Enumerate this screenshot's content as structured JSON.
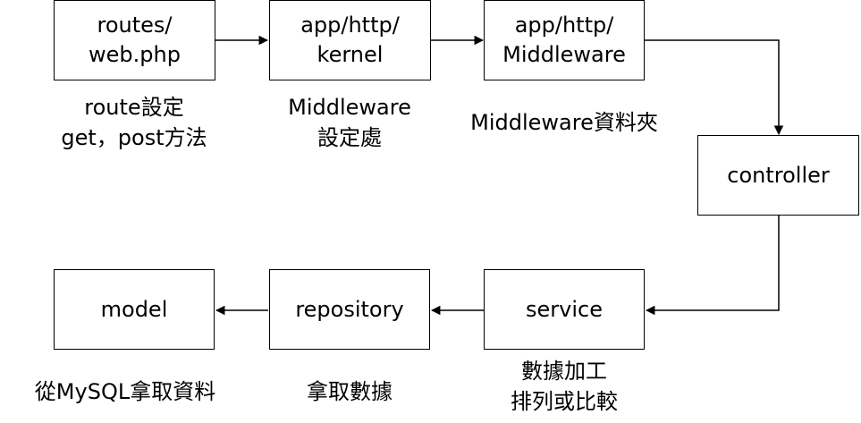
{
  "nodes": {
    "routes": "routes/\nweb.php",
    "kernel": "app/http/\nkernel",
    "middleware": "app/http/\nMiddleware",
    "controller": "controller",
    "service": "service",
    "repository": "repository",
    "model": "model"
  },
  "notes": {
    "routes": "route設定\nget，post方法",
    "kernel": "Middleware\n設定處",
    "middleware": "Middleware資料夾",
    "service": "數據加工\n排列或比較",
    "repository": "拿取數據",
    "model": "從MySQL拿取資料"
  },
  "colors": {
    "stroke": "#000000",
    "fill": "#ffffff",
    "text": "#000000"
  }
}
